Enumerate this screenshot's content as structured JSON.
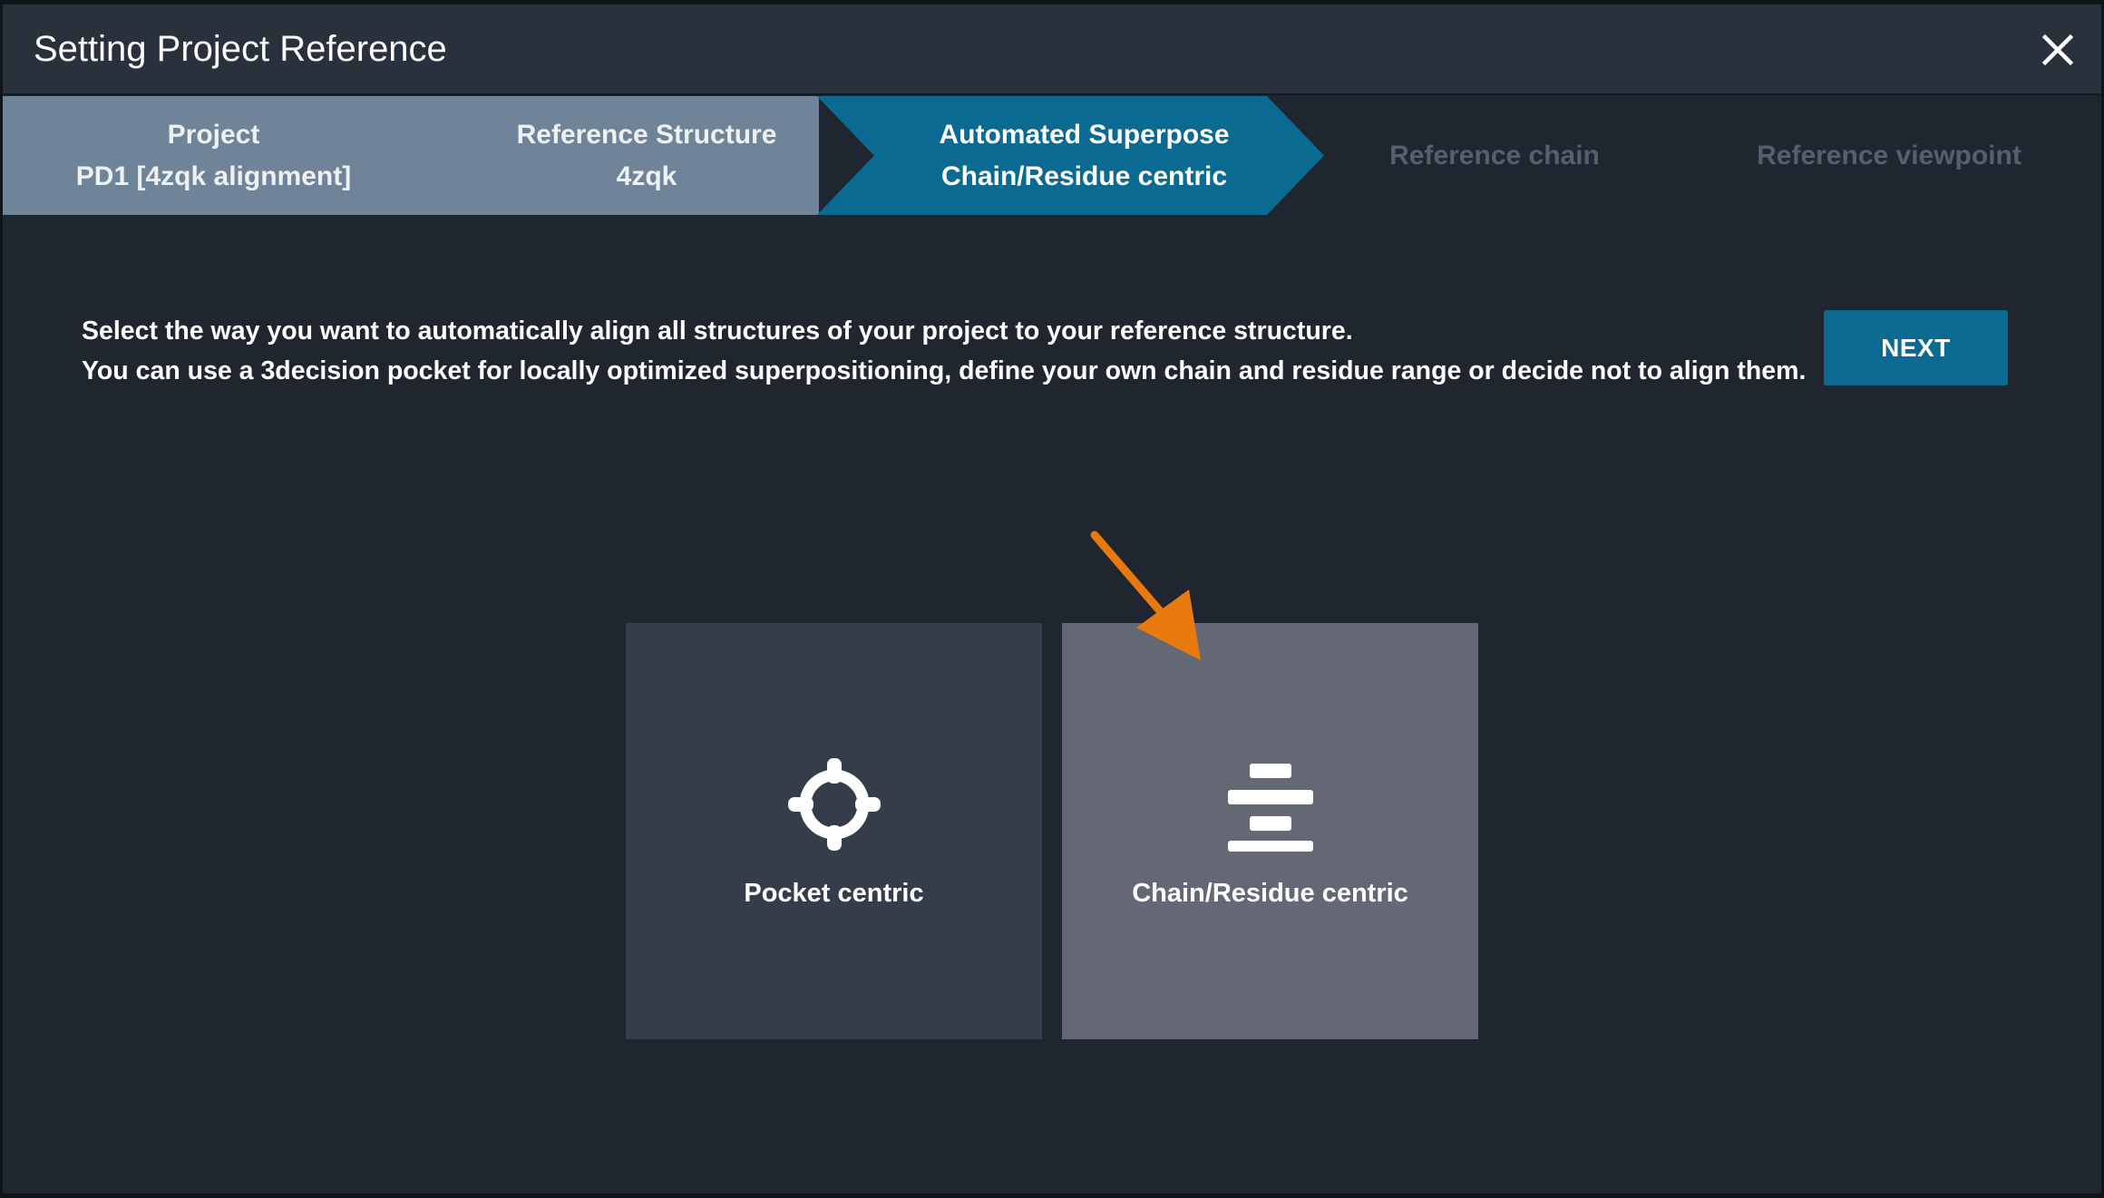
{
  "dialog": {
    "title": "Setting Project Reference",
    "close_icon": "close-icon"
  },
  "stepper": {
    "steps": [
      {
        "title": "Project",
        "subtitle": "PD1 [4zqk alignment]",
        "state": "done"
      },
      {
        "title": "Reference Structure",
        "subtitle": "4zqk",
        "state": "done"
      },
      {
        "title": "Automated Superpose",
        "subtitle": "Chain/Residue centric",
        "state": "active"
      },
      {
        "title": "Reference chain",
        "state": "future"
      },
      {
        "title": "Reference viewpoint",
        "state": "future"
      }
    ]
  },
  "instructions": {
    "line1": "Select the way you want to automatically align all structures of your project to your reference structure.",
    "line2": "You can use a 3decision pocket for locally optimized superpositioning, define your own chain and residue range or decide not to align them."
  },
  "next_button": {
    "label": "NEXT"
  },
  "options": [
    {
      "label": "Pocket centric",
      "icon": "crosshair-icon",
      "selected": false
    },
    {
      "label": "Chain/Residue centric",
      "icon": "align-center-icon",
      "selected": true
    }
  ],
  "colors": {
    "background": "#1f2630",
    "titlebar": "#29313c",
    "step_done": "#6f8498",
    "step_active": "#0b6a92",
    "next_button": "#0b6a92",
    "card_default": "#353c4a",
    "card_selected": "#636874",
    "annotation_arrow": "#e8790f"
  }
}
